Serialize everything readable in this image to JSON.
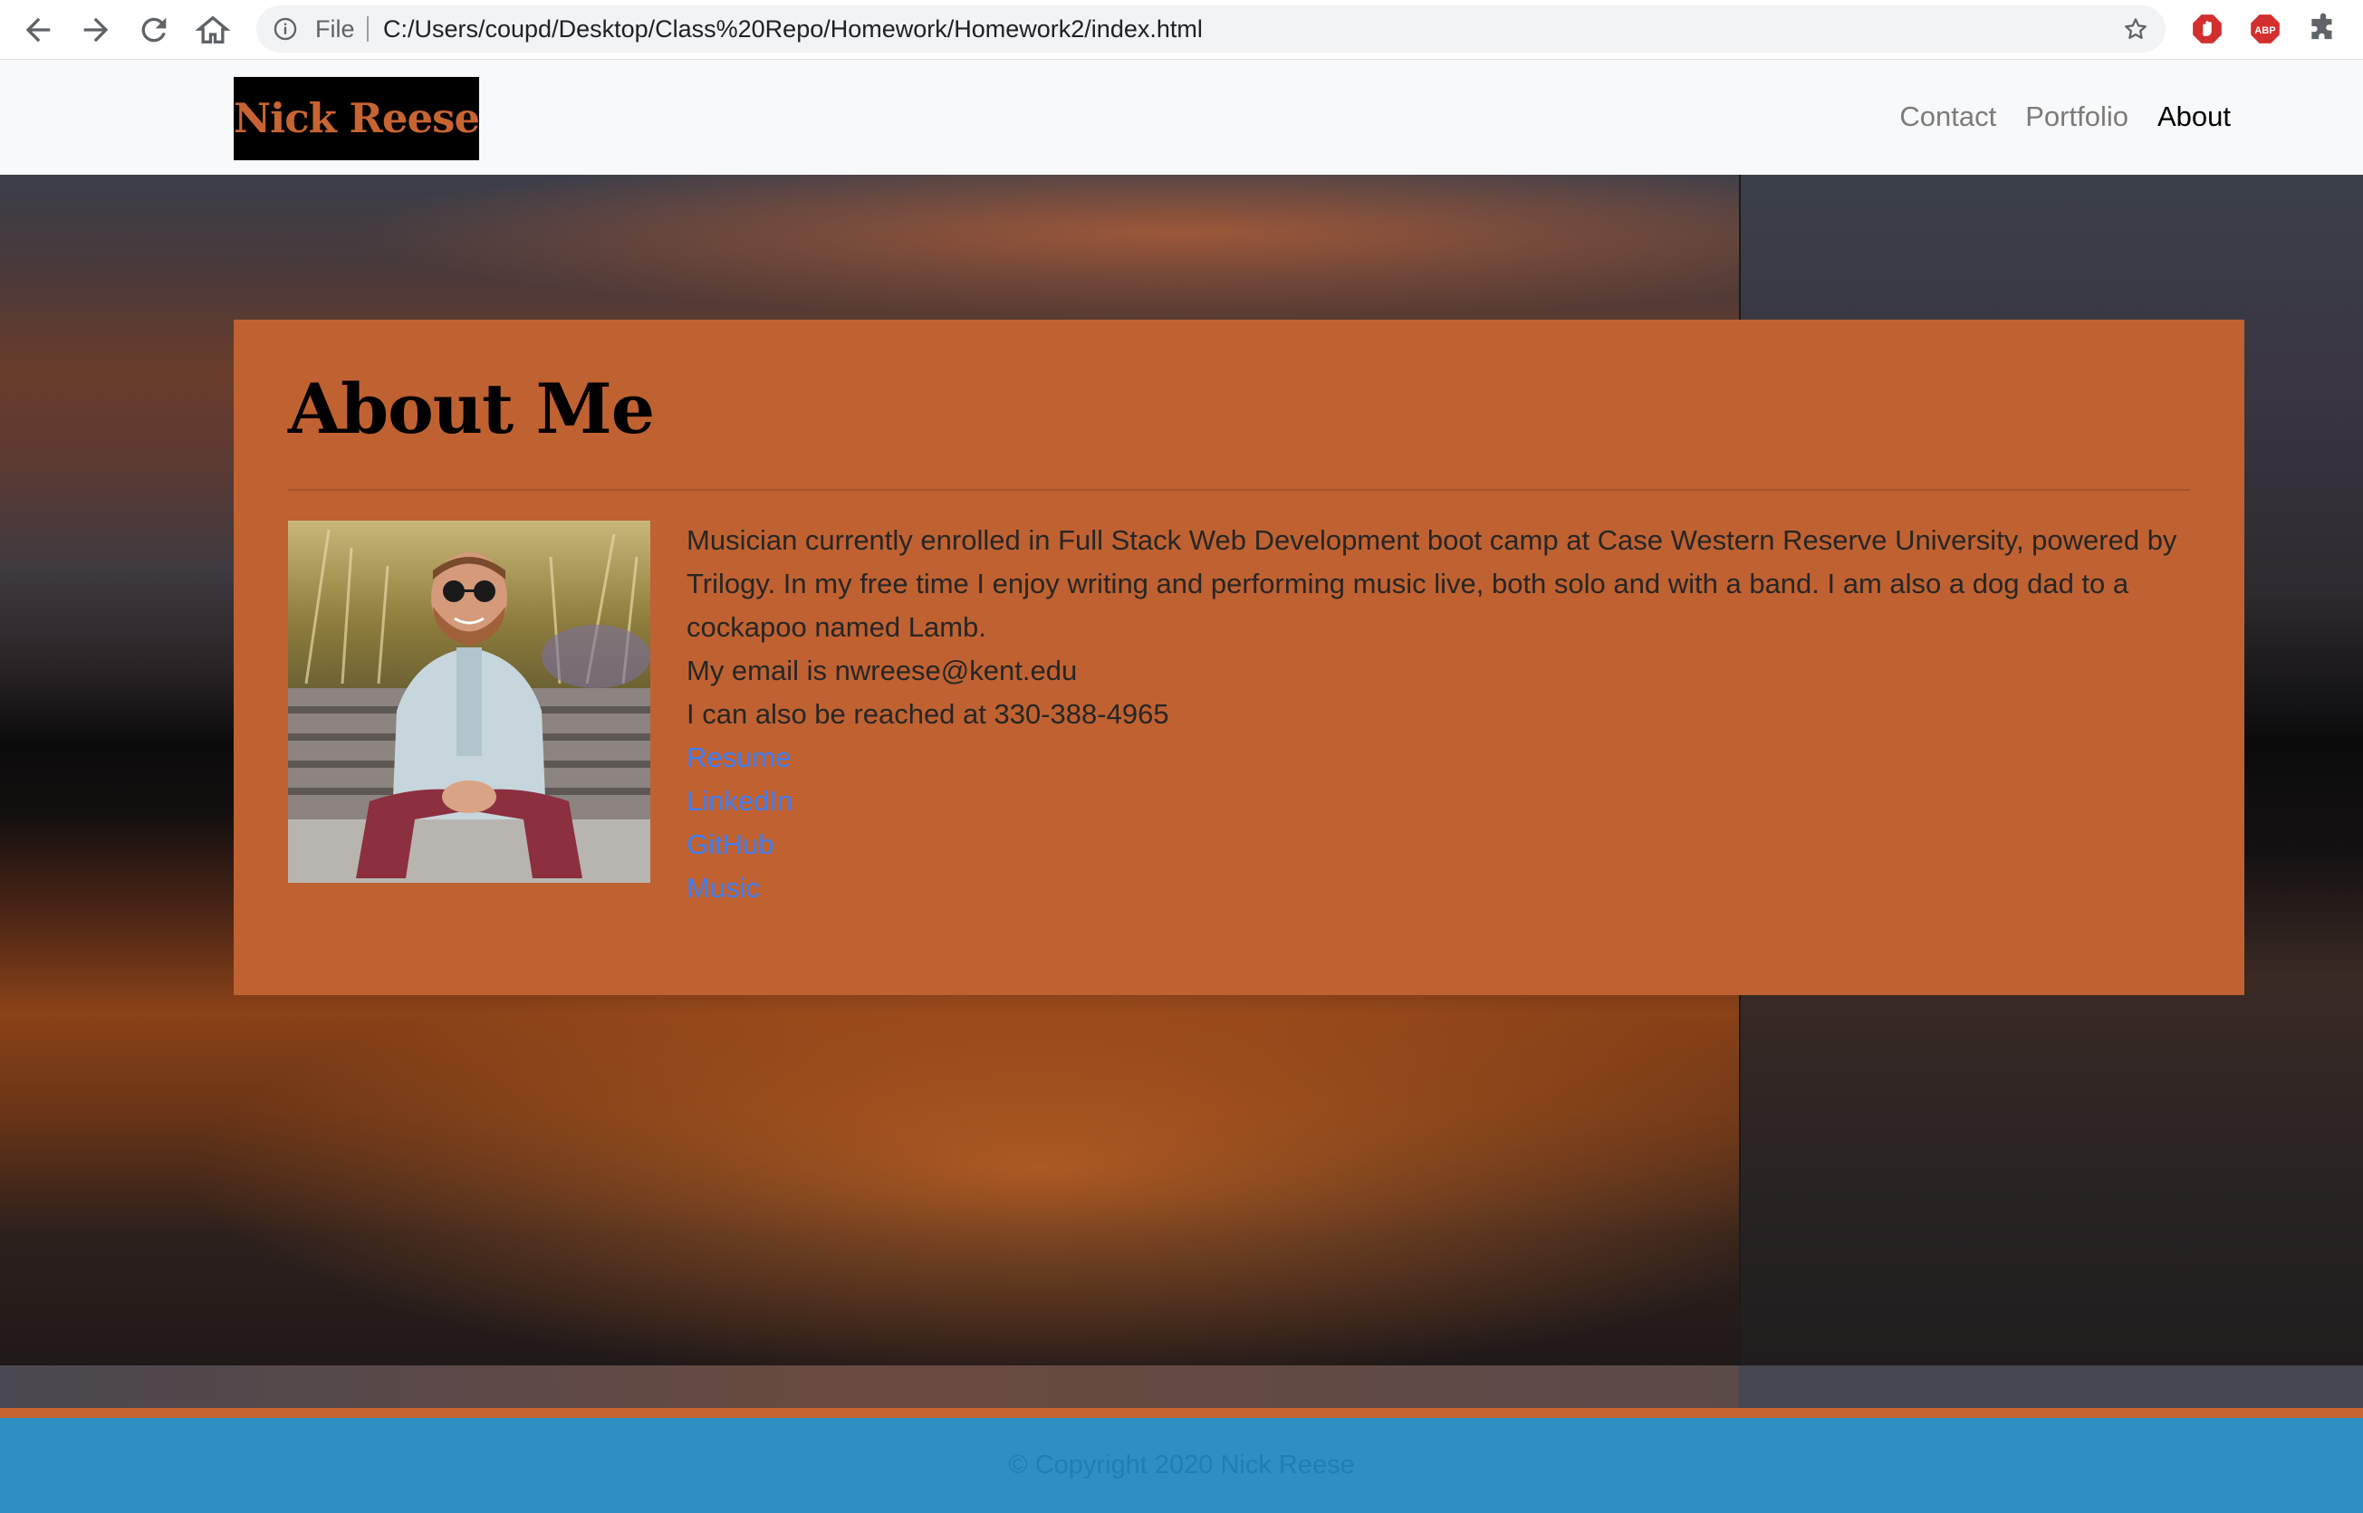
{
  "browser": {
    "scheme_label": "File",
    "url": "C:/Users/coupd/Desktop/Class%20Repo/Homework/Homework2/index.html",
    "icons": [
      "back-arrow-icon",
      "forward-arrow-icon",
      "reload-icon",
      "home-icon",
      "info-icon",
      "star-icon",
      "stop-extension-icon",
      "adblock-extension-icon",
      "puzzle-extensions-icon"
    ],
    "adblock_label": "ABP"
  },
  "navbar": {
    "brand": "Nick Reese",
    "links": [
      {
        "label": "Contact"
      },
      {
        "label": "Portfolio"
      },
      {
        "label": "About",
        "active": true
      }
    ]
  },
  "about": {
    "title": "About Me",
    "bio": "Musician currently enrolled in Full Stack Web Development boot camp at Case Western Reserve University, powered by Trilogy. In my free time I enjoy writing and performing music live, both solo and with a band. I am also a dog dad to a cockapoo named Lamb.",
    "email_line": "My email is nwreese@kent.edu",
    "phone_line": "I can also be reached at 330-388-4965",
    "links": [
      {
        "label": "Resume"
      },
      {
        "label": "LinkedIn"
      },
      {
        "label": "GitHub"
      },
      {
        "label": "Music"
      }
    ]
  },
  "footer": {
    "copyright": "© Copyright 2020 Nick Reese"
  },
  "colors": {
    "accent_orange": "#c06131",
    "footer_blue": "#2f8fc2",
    "link_blue": "#3d7ff7"
  }
}
